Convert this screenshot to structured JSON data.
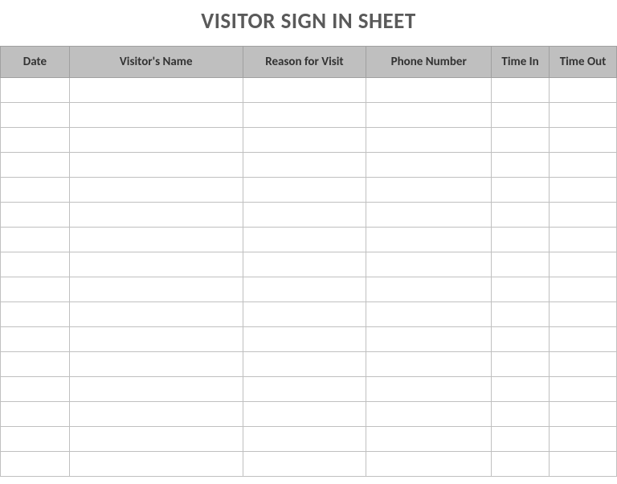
{
  "title": "VISITOR SIGN IN SHEET",
  "columns": [
    {
      "label": "Date"
    },
    {
      "label": "Visitor's Name"
    },
    {
      "label": "Reason for Visit"
    },
    {
      "label": "Phone Number"
    },
    {
      "label": "Time In"
    },
    {
      "label": "Time Out"
    }
  ],
  "row_count": 16
}
